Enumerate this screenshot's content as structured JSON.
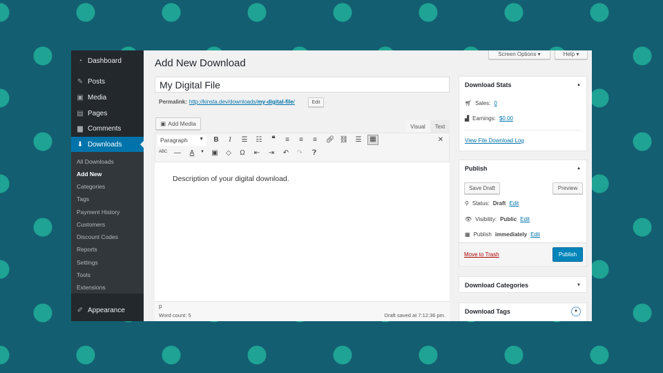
{
  "sidebar": {
    "items": [
      {
        "label": "Dashboard",
        "icon": "dashboard-icon"
      },
      {
        "label": "Posts",
        "icon": "pin-icon"
      },
      {
        "label": "Media",
        "icon": "media-icon"
      },
      {
        "label": "Pages",
        "icon": "pages-icon"
      },
      {
        "label": "Comments",
        "icon": "comment-icon"
      },
      {
        "label": "Downloads",
        "icon": "download-icon"
      }
    ],
    "submenu": [
      "All Downloads",
      "Add New",
      "Categories",
      "Tags",
      "Payment History",
      "Customers",
      "Discount Codes",
      "Reports",
      "Settings",
      "Tools",
      "Extensions"
    ],
    "appearance": "Appearance"
  },
  "header": {
    "screen_options": "Screen Options ▾",
    "help": "Help ▾",
    "title": "Add New Download"
  },
  "post": {
    "title": "My Digital File",
    "permalink_label": "Permalink:",
    "permalink_base": "http://kinsta.dev/downloads/",
    "permalink_slug": "my-digital-file",
    "permalink_end": "/",
    "edit": "Edit"
  },
  "editor": {
    "add_media": "Add Media",
    "tab_visual": "Visual",
    "tab_text": "Text",
    "format": "Paragraph",
    "content": "Description of your digital download.",
    "path": "p",
    "word_count": "Word count: 5",
    "draft_saved": "Draft saved at 7:12:36 pm."
  },
  "stats": {
    "title": "Download Stats",
    "sales_label": "Sales:",
    "sales": "0",
    "earnings_label": "Earnings:",
    "earnings": "$0.00",
    "log": "View File Download Log"
  },
  "publish": {
    "title": "Publish",
    "save_draft": "Save Draft",
    "preview": "Preview",
    "status_label": "Status:",
    "status": "Draft",
    "visibility_label": "Visibility:",
    "visibility": "Public",
    "publish_label": "Publish",
    "publish_when": "immediately",
    "edit": "Edit",
    "trash": "Move to Trash",
    "publish_button": "Publish"
  },
  "categories": {
    "title": "Download Categories"
  },
  "tags": {
    "title": "Download Tags"
  },
  "colors": {
    "accent": "#0073aa",
    "sidebar": "#23282d",
    "trash": "#a00"
  }
}
